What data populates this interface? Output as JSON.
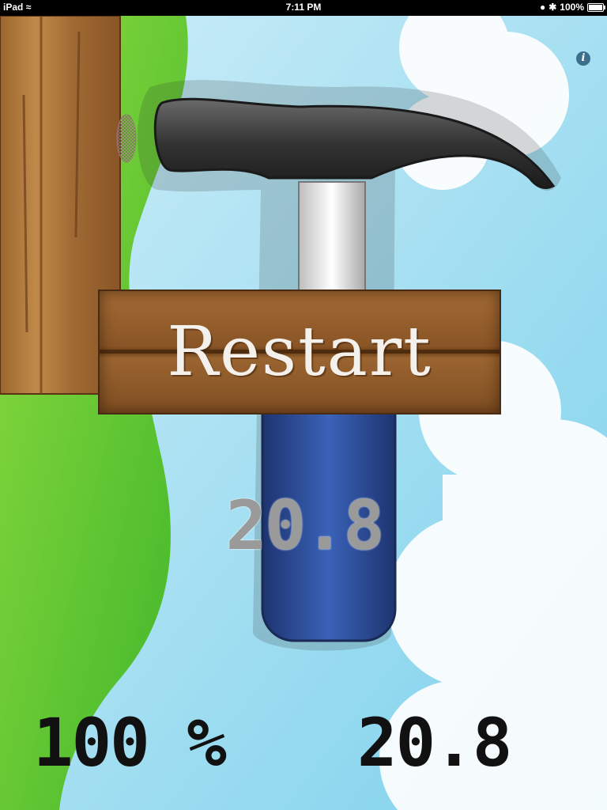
{
  "status_bar": {
    "device": "iPad",
    "time": "7:11 PM",
    "battery": "100%"
  },
  "info_button": {
    "label": "i",
    "icon": "info-icon"
  },
  "restart_button": {
    "label": "Restart"
  },
  "score": {
    "current": "20.8",
    "accuracy": "100 %",
    "total": "20.8"
  },
  "colors": {
    "sky": "#8fd8ef",
    "grass": "#56c22f",
    "wood": "#8a5526",
    "hammer_handle": "#2e4f9c"
  }
}
